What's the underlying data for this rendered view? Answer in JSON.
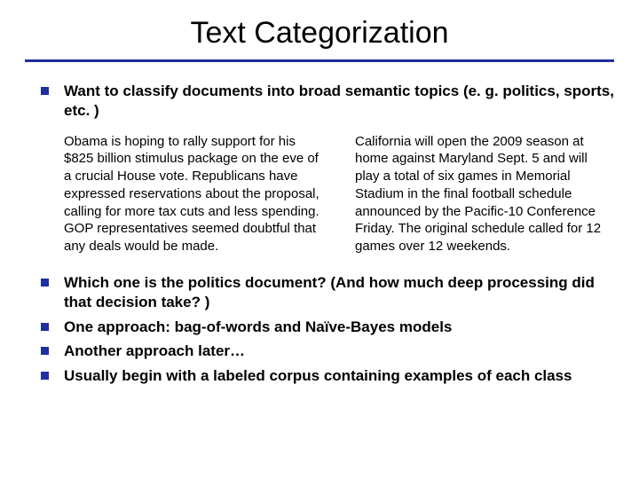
{
  "title": "Text Categorization",
  "intro": "Want to classify documents into broad semantic topics (e. g. politics, sports, etc. )",
  "examples": {
    "left": "Obama is hoping to rally support for his $825 billion stimulus package on the eve of a crucial House vote. Republicans have expressed reservations about the proposal, calling for more tax cuts and less spending. GOP representatives seemed doubtful that any deals would be made.",
    "right": "California will open the 2009 season at home against Maryland Sept. 5 and will play a total of six games in Memorial Stadium in the final football schedule announced by the Pacific-10 Conference Friday. The original schedule called for 12 games over 12 weekends."
  },
  "points": [
    "Which one is the politics document? (And how much deep processing did that decision take? )",
    "One approach: bag-of-words and Naïve-Bayes models",
    "Another approach later…",
    "Usually begin with a labeled corpus containing examples of each class"
  ]
}
